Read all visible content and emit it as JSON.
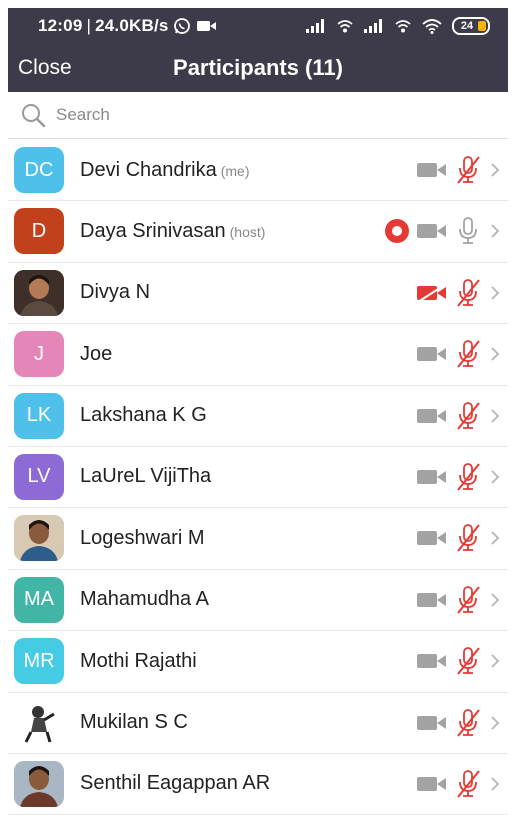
{
  "status": {
    "time": "12:09",
    "speed": "24.0KB/s",
    "battery": "24"
  },
  "nav": {
    "close_label": "Close",
    "title": "Participants (11)"
  },
  "search": {
    "placeholder": "Search"
  },
  "participants": [
    {
      "initials": "DC",
      "name": "Devi Chandrika",
      "tag": "(me)",
      "avatar_color": "#4fc0ea",
      "avatar_type": "initials",
      "video": "off",
      "audio": "muted",
      "recording": false
    },
    {
      "initials": "D",
      "name": "Daya Srinivasan",
      "tag": "(host)",
      "avatar_color": "#c2401b",
      "avatar_type": "initials",
      "video": "off",
      "audio": "unmuted",
      "recording": true
    },
    {
      "initials": "",
      "name": "Divya N",
      "tag": "",
      "avatar_color": "#4a3a32",
      "avatar_type": "photo-girl",
      "video": "blocked",
      "audio": "muted",
      "recording": false
    },
    {
      "initials": "J",
      "name": "Joe",
      "tag": "",
      "avatar_color": "#e586b8",
      "avatar_type": "initials",
      "video": "off",
      "audio": "muted",
      "recording": false
    },
    {
      "initials": "LK",
      "name": "Lakshana K G",
      "tag": "",
      "avatar_color": "#4fc0ea",
      "avatar_type": "initials",
      "video": "off",
      "audio": "muted",
      "recording": false
    },
    {
      "initials": "LV",
      "name": "LaUreL VijiTha",
      "tag": "",
      "avatar_color": "#8e6ad6",
      "avatar_type": "initials",
      "video": "off",
      "audio": "muted",
      "recording": false
    },
    {
      "initials": "",
      "name": "Logeshwari M",
      "tag": "",
      "avatar_color": "#c9b49a",
      "avatar_type": "photo-woman",
      "video": "off",
      "audio": "muted",
      "recording": false
    },
    {
      "initials": "MA",
      "name": "Mahamudha A",
      "tag": "",
      "avatar_color": "#42b6a6",
      "avatar_type": "initials",
      "video": "off",
      "audio": "muted",
      "recording": false
    },
    {
      "initials": "MR",
      "name": "Mothi Rajathi",
      "tag": "",
      "avatar_color": "#45cbe3",
      "avatar_type": "initials",
      "video": "off",
      "audio": "muted",
      "recording": false
    },
    {
      "initials": "",
      "name": "Mukilan S C",
      "tag": "",
      "avatar_color": "#f4f4f4",
      "avatar_type": "illustration",
      "video": "off",
      "audio": "muted",
      "recording": false
    },
    {
      "initials": "",
      "name": "Senthil Eagappan AR",
      "tag": "",
      "avatar_color": "#cfcfcf",
      "avatar_type": "photo-man",
      "video": "off",
      "audio": "muted",
      "recording": false
    }
  ],
  "colors": {
    "header_bg": "#3d3b49",
    "muted_red": "#e53935",
    "icon_gray": "#9e9e9e"
  }
}
